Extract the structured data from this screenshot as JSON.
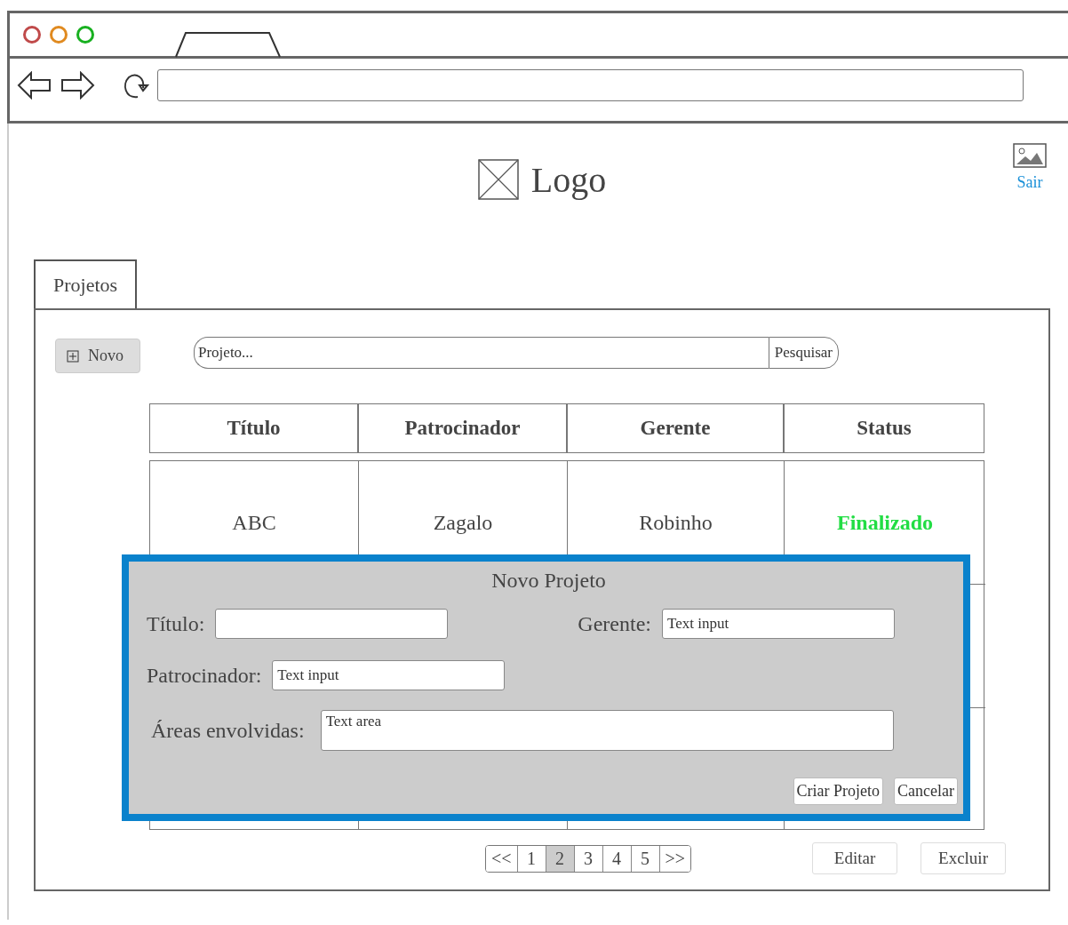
{
  "header": {
    "logo": "Logo",
    "logout": "Sair"
  },
  "tabs": [
    {
      "label": "Projetos",
      "selected": true
    }
  ],
  "new_button": "Novo",
  "search": {
    "placeholder": "Projeto...",
    "button": "Pesquisar"
  },
  "table": {
    "columns": [
      "Título",
      "Patrocinador",
      "Gerente",
      "Status"
    ],
    "rows": [
      {
        "cells": [
          "ABC",
          "Zagalo",
          "Robinho",
          "Finalizado"
        ],
        "color": "#22dd44"
      }
    ]
  },
  "dialog": {
    "title": "Novo Projeto",
    "fields": [
      {
        "label": "Título:"
      },
      {
        "label": "Gerente:",
        "value": "Text input"
      },
      {
        "label": "Patrocinador:",
        "value": "Text input"
      },
      {
        "label": "Áreas envolvidas:",
        "value": "Text area"
      }
    ],
    "buttons": [
      "Criar Projeto",
      "Cancelar"
    ]
  },
  "pagination": [
    {
      "label": "<<",
      "selected": false
    },
    {
      "label": "1",
      "selected": false
    },
    {
      "label": "2",
      "selected": true
    },
    {
      "label": "3",
      "selected": false
    },
    {
      "label": "4",
      "selected": false
    },
    {
      "label": "5",
      "selected": false
    },
    {
      "label": ">>",
      "selected": false
    }
  ],
  "actions": [
    "Editar",
    "Excluir"
  ]
}
